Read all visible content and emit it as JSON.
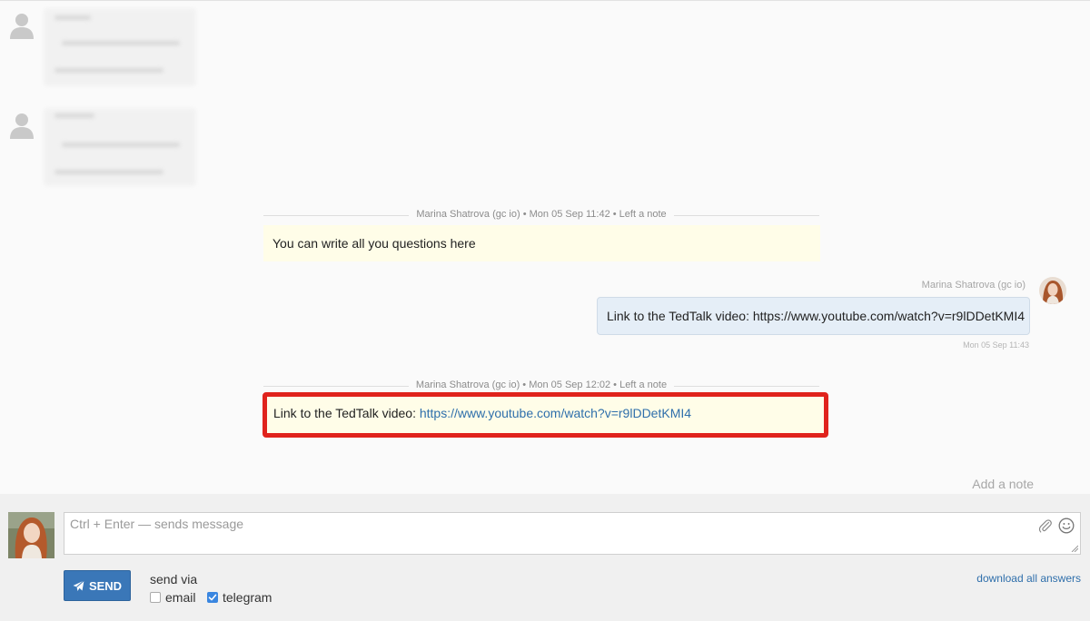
{
  "notes": [
    {
      "header": "Marina Shatrova (gc io) • Mon 05 Sep 11:42 • Left a note",
      "text": "You can write all you questions here"
    },
    {
      "header": "Marina Shatrova (gc io) • Mon 05 Sep 12:02 • Left a note",
      "text_prefix": "Link to the TedTalk video: ",
      "link": "https://www.youtube.com/watch?v=r9lDDetKMI4"
    }
  ],
  "outgoing": {
    "author": "Marina Shatrova (gc io)",
    "text": "Link to the TedTalk video: https://www.youtube.com/watch?v=r9lDDetKMI4",
    "time": "Mon 05 Sep 11:43"
  },
  "add_note_label": "Add a note",
  "composer": {
    "placeholder": "Ctrl + Enter — sends message",
    "send_label": "SEND",
    "send_via_label": "send via",
    "options": [
      {
        "label": "email",
        "checked": false
      },
      {
        "label": "telegram",
        "checked": true
      }
    ],
    "download_label": "download all answers"
  },
  "colors": {
    "accent": "#3a77b8",
    "highlight_border": "#e0231c",
    "note_bg": "#fffde8",
    "outgoing_bg": "#e5eef7"
  },
  "icons": [
    "user-silhouette-icon",
    "paperclip-icon",
    "smiley-icon",
    "paper-plane-icon",
    "checkmark-icon"
  ]
}
